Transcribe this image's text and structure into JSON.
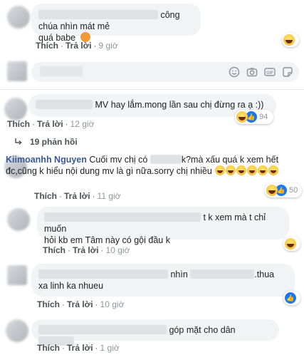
{
  "comments": [
    {
      "text_suffix": "công chúa nhìn mát mẻ",
      "text_line2": "quá babe",
      "actions": {
        "like": "Thích",
        "reply": "Trả lời",
        "time": "9 giờ"
      }
    },
    {
      "text": "MV hay lắm.mong lần sau chị đừng ra ạ :))",
      "reaction_count": "94",
      "actions": {
        "like": "Thích",
        "reply": "Trả lời",
        "time": "12 giờ"
      }
    },
    {
      "name": "Kiimoanhh Nguyen",
      "text_part1": "Cuối mv chị có",
      "text_part2": "k?mà xấu quá k xem hết",
      "text_line2": "đc,cũng k hiểu nội dung mv là gì nữa.sorry chị nhiều",
      "reaction_count": "50",
      "actions": {
        "like": "Thích",
        "reply": "Trả lời",
        "time": "11 giờ"
      }
    },
    {
      "text_suffix": "t k xem mà t chỉ muốn",
      "text_line2": "hỏi kb em Tâm này có gội đầu k",
      "actions": {
        "like": "Thích",
        "reply": "Trả lời",
        "time": "10 giờ"
      }
    },
    {
      "text_part1": "nhìn",
      "text_part2": ".thua",
      "text_line2": "xa linh ka nhueu",
      "actions": {
        "like": "Thích",
        "reply": "Trả lời",
        "time": "10 giờ"
      }
    },
    {
      "text": "góp mặt cho dân",
      "actions": {
        "like": "Thích",
        "reply": "Trả lời",
        "time": "1 giờ"
      }
    }
  ],
  "replies_link": "19 phản hồi",
  "composer_icons": [
    "emoji-icon",
    "camera-icon",
    "gif-icon",
    "sticker-icon"
  ],
  "gif_label": "GIF",
  "colors": {
    "link": "#385898",
    "bubble": "#f2f3f5",
    "like_blue": "#1877f2",
    "haha_yellow": "#f7c23e"
  }
}
